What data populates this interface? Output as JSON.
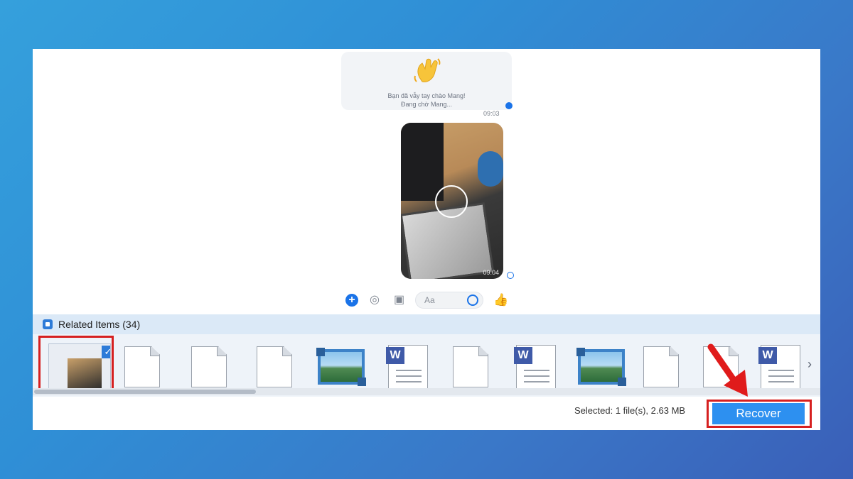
{
  "preview": {
    "greeting_line1": "Bạn đã vẫy tay chào Mang!",
    "greeting_line2": "Đang chờ Mang...",
    "time1": "09:03",
    "time2": "09:04",
    "composer_placeholder": "Aa"
  },
  "related": {
    "label": "Related Items (34)",
    "items": [
      {
        "type": "image-selected"
      },
      {
        "type": "blank-file"
      },
      {
        "type": "blank-file"
      },
      {
        "type": "blank-file"
      },
      {
        "type": "image-file"
      },
      {
        "type": "word-doc"
      },
      {
        "type": "blank-file"
      },
      {
        "type": "word-doc"
      },
      {
        "type": "image-file"
      },
      {
        "type": "blank-file"
      },
      {
        "type": "blank-file"
      },
      {
        "type": "word-doc"
      }
    ]
  },
  "footer": {
    "selected_text": "Selected: 1 file(s), 2.63 MB",
    "recover_label": "Recover"
  },
  "colors": {
    "accent": "#2d90f0",
    "highlight": "#d62020"
  },
  "icons": [
    "waving-hand-icon",
    "plus-icon",
    "camera-icon",
    "image-icon",
    "emoji-icon",
    "thumbs-up-icon",
    "chevron-right-icon",
    "checkmark-icon",
    "word-icon"
  ]
}
